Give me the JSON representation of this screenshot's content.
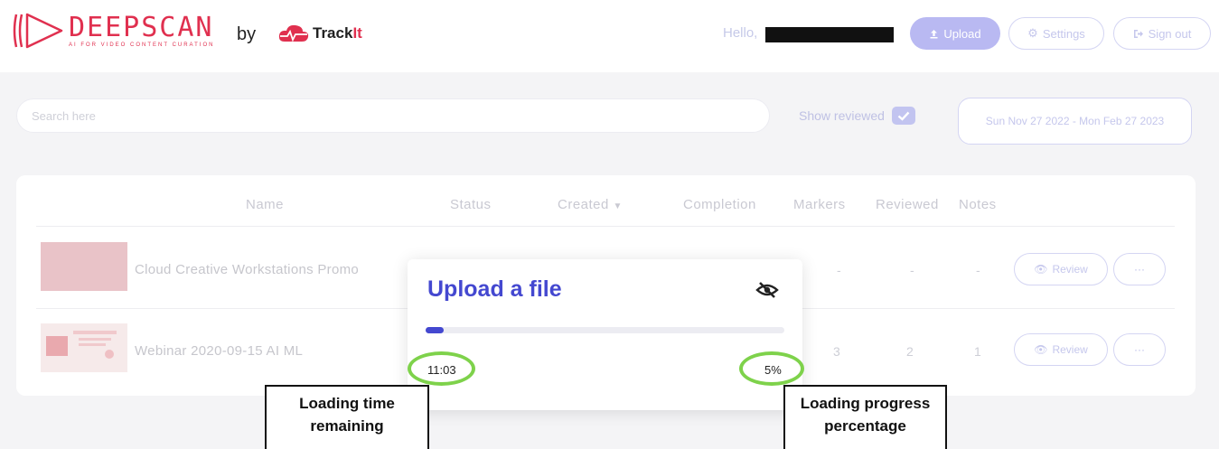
{
  "header": {
    "logo_word": "DEEPSCAN",
    "logo_tagline": "AI FOR VIDEO CONTENT CURATION",
    "by": "by",
    "partner_prefix": "Track",
    "partner_suffix": "It",
    "greeting": "Hello,",
    "upload_label": "Upload",
    "settings_label": "Settings",
    "signout_label": "Sign out"
  },
  "toolbar": {
    "search_placeholder": "Search here",
    "show_reviewed_label": "Show reviewed",
    "show_reviewed_checked": true,
    "date_range": "Sun Nov 27 2022 - Mon Feb 27 2023"
  },
  "table": {
    "columns": [
      "Name",
      "Status",
      "Created",
      "Completion",
      "Markers",
      "Reviewed",
      "Notes"
    ],
    "rows": [
      {
        "name": "Cloud Creative Workstations Promo",
        "markers": "-",
        "reviewed": "-",
        "notes": "-",
        "review_label": "Review",
        "more_label": "···"
      },
      {
        "name": "Webinar 2020-09-15 AI ML",
        "markers": "3",
        "reviewed": "2",
        "notes": "1",
        "review_label": "Review",
        "more_label": "···"
      }
    ]
  },
  "upload_modal": {
    "title": "Upload a file",
    "progress_fraction": 0.05,
    "time_remaining": "11:03",
    "progress_percent": "5%"
  },
  "annotations": {
    "time_line1": "Loading time",
    "time_line2": "remaining",
    "progress_line1": "Loading progress",
    "progress_line2": "percentage",
    "highlight_color": "#7ed24b"
  },
  "colors": {
    "brand_red": "#e0304f",
    "accent_blue": "#4448d0"
  }
}
